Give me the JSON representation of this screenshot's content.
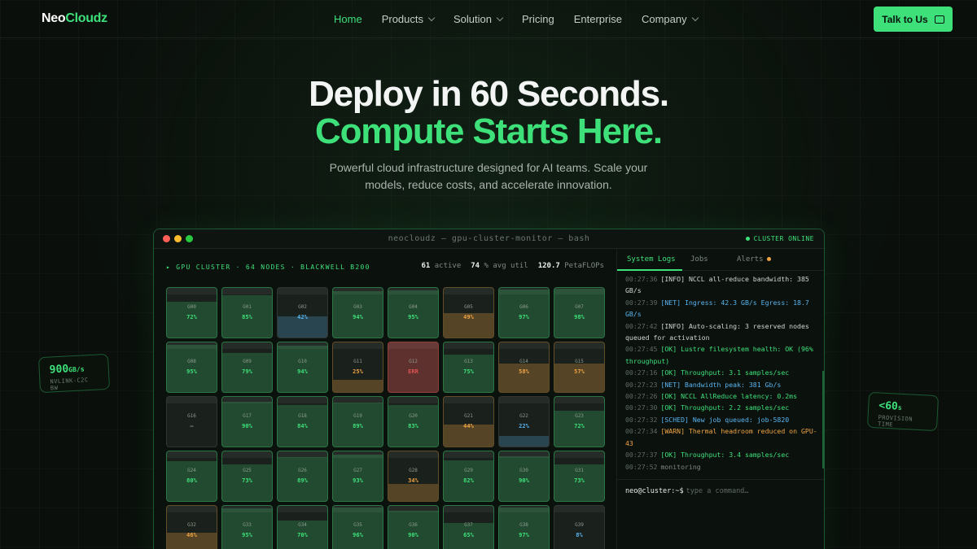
{
  "nav": {
    "logo_a": "Neo",
    "logo_b": "Cloudz",
    "links": [
      {
        "label": "Home",
        "active": true,
        "dropdown": false
      },
      {
        "label": "Products",
        "active": false,
        "dropdown": true
      },
      {
        "label": "Solution",
        "active": false,
        "dropdown": true
      },
      {
        "label": "Pricing",
        "active": false,
        "dropdown": false
      },
      {
        "label": "Enterprise",
        "active": false,
        "dropdown": false
      },
      {
        "label": "Company",
        "active": false,
        "dropdown": true
      }
    ],
    "cta": "Talk to Us"
  },
  "hero": {
    "line1": "Deploy in 60 Seconds.",
    "line2": "Compute Starts Here.",
    "sub1": "Powerful cloud infrastructure designed for AI teams. Scale your",
    "sub2": "models, reduce costs, and accelerate innovation."
  },
  "cards": {
    "left_value": "900",
    "left_unit": "GB/s",
    "left_label": "NVLINK-C2C BW",
    "right_value": "<60",
    "right_unit": "s",
    "right_label": "PROVISION TIME"
  },
  "terminal": {
    "title": "neocloudz — gpu-cluster-monitor — bash",
    "status": "CLUSTER ONLINE",
    "cluster_head": "▸ GPU CLUSTER · 64 NODES · BLACKWELL B200",
    "stats": [
      {
        "value": "61",
        "label": "active"
      },
      {
        "value": "74",
        "label": "% avg util"
      },
      {
        "value": "120.7",
        "label": "PetaFLOPs"
      }
    ],
    "gpus": [
      {
        "id": "G00",
        "val": "72%",
        "pct": 72,
        "state": "ok"
      },
      {
        "id": "G01",
        "val": "85%",
        "pct": 85,
        "state": "ok"
      },
      {
        "id": "G02",
        "val": "42%",
        "pct": 42,
        "state": "blue"
      },
      {
        "id": "G03",
        "val": "94%",
        "pct": 94,
        "state": "ok"
      },
      {
        "id": "G04",
        "val": "95%",
        "pct": 95,
        "state": "ok"
      },
      {
        "id": "G05",
        "val": "49%",
        "pct": 49,
        "state": "warn"
      },
      {
        "id": "G06",
        "val": "97%",
        "pct": 97,
        "state": "ok"
      },
      {
        "id": "G07",
        "val": "98%",
        "pct": 98,
        "state": "ok"
      },
      {
        "id": "G08",
        "val": "95%",
        "pct": 95,
        "state": "ok"
      },
      {
        "id": "G09",
        "val": "79%",
        "pct": 79,
        "state": "ok"
      },
      {
        "id": "G10",
        "val": "94%",
        "pct": 94,
        "state": "ok"
      },
      {
        "id": "G11",
        "val": "25%",
        "pct": 25,
        "state": "warn"
      },
      {
        "id": "G12",
        "val": "ERR",
        "pct": 100,
        "state": "err"
      },
      {
        "id": "G13",
        "val": "75%",
        "pct": 75,
        "state": "ok"
      },
      {
        "id": "G14",
        "val": "58%",
        "pct": 58,
        "state": "warn"
      },
      {
        "id": "G15",
        "val": "57%",
        "pct": 57,
        "state": "warn"
      },
      {
        "id": "G16",
        "val": "—",
        "pct": 0,
        "state": "idle"
      },
      {
        "id": "G17",
        "val": "90%",
        "pct": 90,
        "state": "ok"
      },
      {
        "id": "G18",
        "val": "84%",
        "pct": 84,
        "state": "ok"
      },
      {
        "id": "G19",
        "val": "89%",
        "pct": 89,
        "state": "ok"
      },
      {
        "id": "G20",
        "val": "83%",
        "pct": 83,
        "state": "ok"
      },
      {
        "id": "G21",
        "val": "44%",
        "pct": 44,
        "state": "warn"
      },
      {
        "id": "G22",
        "val": "22%",
        "pct": 22,
        "state": "blue"
      },
      {
        "id": "G23",
        "val": "72%",
        "pct": 72,
        "state": "ok"
      },
      {
        "id": "G24",
        "val": "80%",
        "pct": 80,
        "state": "ok"
      },
      {
        "id": "G25",
        "val": "73%",
        "pct": 73,
        "state": "ok"
      },
      {
        "id": "G26",
        "val": "89%",
        "pct": 89,
        "state": "ok"
      },
      {
        "id": "G27",
        "val": "93%",
        "pct": 93,
        "state": "ok"
      },
      {
        "id": "G28",
        "val": "34%",
        "pct": 34,
        "state": "warn"
      },
      {
        "id": "G29",
        "val": "82%",
        "pct": 82,
        "state": "ok"
      },
      {
        "id": "G30",
        "val": "90%",
        "pct": 90,
        "state": "ok"
      },
      {
        "id": "G31",
        "val": "73%",
        "pct": 73,
        "state": "ok"
      },
      {
        "id": "G32",
        "val": "46%",
        "pct": 46,
        "state": "warn"
      },
      {
        "id": "G33",
        "val": "95%",
        "pct": 95,
        "state": "ok"
      },
      {
        "id": "G34",
        "val": "70%",
        "pct": 70,
        "state": "ok"
      },
      {
        "id": "G35",
        "val": "96%",
        "pct": 96,
        "state": "ok"
      },
      {
        "id": "G36",
        "val": "90%",
        "pct": 90,
        "state": "ok"
      },
      {
        "id": "G37",
        "val": "65%",
        "pct": 65,
        "state": "ok"
      },
      {
        "id": "G38",
        "val": "97%",
        "pct": 97,
        "state": "ok"
      },
      {
        "id": "G39",
        "val": "8%",
        "pct": 8,
        "state": "blue"
      }
    ],
    "tabs": [
      {
        "label": "System Logs",
        "active": true
      },
      {
        "label": "Jobs",
        "active": false
      },
      {
        "label": "Alerts",
        "active": false
      }
    ],
    "logs": [
      {
        "t": "00:27:36",
        "tag": "[INFO]",
        "msg": "NCCL all-reduce bandwidth: 385 GB/s",
        "kind": "info"
      },
      {
        "t": "00:27:39",
        "tag": "[NET]",
        "msg": "Ingress: 42.3 GB/s Egress: 18.7 GB/s",
        "kind": "net"
      },
      {
        "t": "00:27:42",
        "tag": "[INFO]",
        "msg": "Auto-scaling: 3 reserved nodes queued for activation",
        "kind": "info"
      },
      {
        "t": "00:27:45",
        "tag": "[OK]",
        "msg": "Lustre filesystem health: OK (96% throughput)",
        "kind": "ok"
      },
      {
        "t": "00:27:16",
        "tag": "[OK]",
        "msg": "Throughput: 3.1 samples/sec",
        "kind": "ok"
      },
      {
        "t": "00:27:23",
        "tag": "[NET]",
        "msg": "Bandwidth peak: 381 Gb/s",
        "kind": "net"
      },
      {
        "t": "00:27:26",
        "tag": "[OK]",
        "msg": "NCCL AllReduce latency: 0.2ms",
        "kind": "ok"
      },
      {
        "t": "00:27:30",
        "tag": "[OK]",
        "msg": "Throughput: 2.2 samples/sec",
        "kind": "ok"
      },
      {
        "t": "00:27:32",
        "tag": "[SCHED]",
        "msg": "New job queued: job-5820",
        "kind": "sched"
      },
      {
        "t": "00:27:34",
        "tag": "[WARN]",
        "msg": "Thermal headroom reduced on GPU-43",
        "kind": "warn"
      },
      {
        "t": "00:27:37",
        "tag": "[OK]",
        "msg": "Throughput: 3.4 samples/sec",
        "kind": "ok"
      },
      {
        "t": "00:27:52",
        "tag": "",
        "msg": "monitoring",
        "kind": "dim"
      }
    ],
    "prompt": "neo@cluster:~$",
    "placeholder": "type a command…"
  },
  "colors": {
    "accent": "#3ee07a",
    "warn": "#f0a444",
    "blue": "#58b4f0",
    "err": "#e05252"
  }
}
